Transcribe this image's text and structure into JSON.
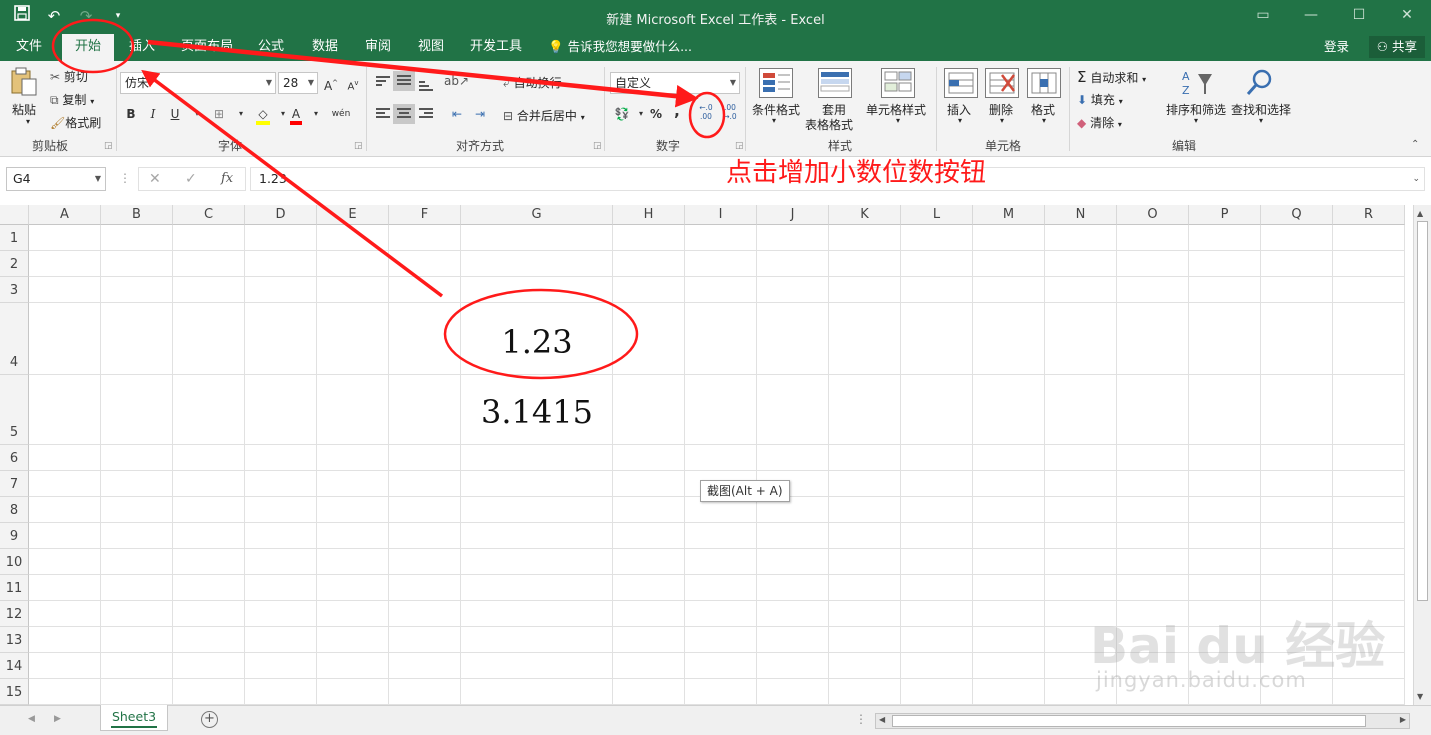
{
  "app": {
    "title": "新建 Microsoft Excel 工作表 - Excel",
    "brand_color": "#217346"
  },
  "qat": {
    "save_icon": "save-icon",
    "undo_icon": "undo-icon",
    "redo_icon": "redo-icon",
    "customize_icon": "chevron-down-icon"
  },
  "tabs": [
    {
      "label": "文件"
    },
    {
      "label": "开始"
    },
    {
      "label": "插入"
    },
    {
      "label": "页面布局"
    },
    {
      "label": "公式"
    },
    {
      "label": "数据"
    },
    {
      "label": "审阅"
    },
    {
      "label": "视图"
    },
    {
      "label": "开发工具"
    }
  ],
  "tell_me": "告诉我您想要做什么...",
  "login": "登录",
  "share": "共享",
  "ribbon": {
    "clipboard": {
      "paste": "粘贴",
      "cut": "剪切",
      "copy": "复制",
      "format_painter": "格式刷",
      "label": "剪贴板"
    },
    "font": {
      "name": "仿宋",
      "size": "28",
      "bold": "B",
      "italic": "I",
      "underline": "U",
      "label": "字体",
      "phonetic": "wén"
    },
    "alignment": {
      "wrap": "自动换行",
      "merge": "合并后居中",
      "label": "对齐方式"
    },
    "number": {
      "format": "自定义",
      "percent": "%",
      "comma": ",",
      "label": "数字"
    },
    "styles": {
      "conditional": "条件格式",
      "table": [
        "套用",
        "表格格式"
      ],
      "cell": "单元格样式",
      "label": "样式"
    },
    "cells": {
      "insert": "插入",
      "delete": "删除",
      "format": "格式",
      "label": "单元格"
    },
    "editing": {
      "autosum": "自动求和",
      "fill": "填充",
      "clear": "清除",
      "sort": "排序和筛选",
      "find": "查找和选择",
      "label": "编辑"
    }
  },
  "formula_bar": {
    "name_box": "G4",
    "value": "1.23",
    "fx": "fx"
  },
  "annotation": {
    "text": "点击增加小数位数按钮",
    "color": "#ff1a1a"
  },
  "columns": [
    "A",
    "B",
    "C",
    "D",
    "E",
    "F",
    "G",
    "H",
    "I",
    "J",
    "K",
    "L",
    "M",
    "N",
    "O",
    "P",
    "Q",
    "R"
  ],
  "rows": [
    "1",
    "2",
    "3",
    "4",
    "5",
    "6",
    "7",
    "8",
    "9",
    "10",
    "11",
    "12",
    "13",
    "14",
    "15"
  ],
  "cells": {
    "G4": "1.23",
    "G5": "3.1415"
  },
  "tooltip": "截图(Alt + A)",
  "sheet": {
    "active": "Sheet3"
  },
  "watermark": {
    "main": "Bai du 经验",
    "sub": "jingyan.baidu.com"
  }
}
